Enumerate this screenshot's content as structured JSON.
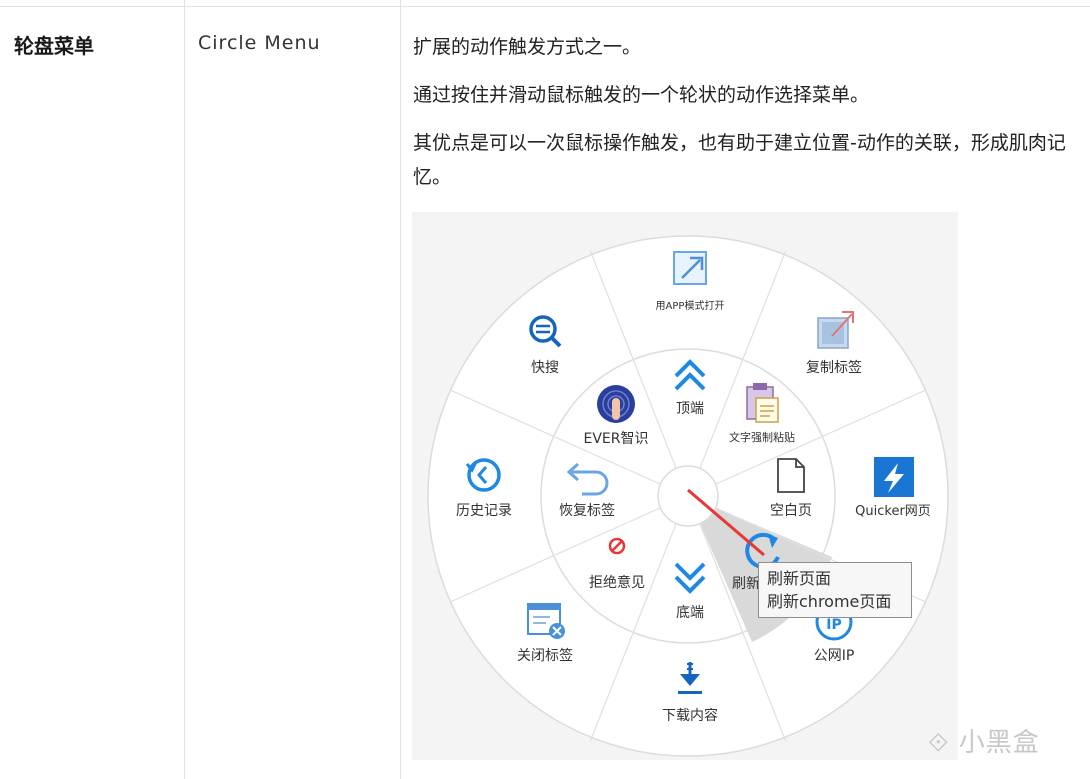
{
  "row": {
    "term": "轮盘菜单",
    "english": "Circle Menu",
    "paragraphs": [
      "扩展的动作触发方式之一。",
      "通过按住并滑动鼠标触发的一个轮状的动作选择菜单。",
      "其优点是可以一次鼠标操作触发，也有助于建立位置-动作的关联，形成肌肉记忆。"
    ]
  },
  "menu": {
    "outer": [
      {
        "label": "用APP模式打开",
        "icon": "open-app-icon"
      },
      {
        "label": "复制标签",
        "icon": "copy-tab-icon"
      },
      {
        "label": "Quicker网页",
        "icon": "quicker-lightning-icon"
      },
      {
        "label": "公网IP",
        "icon": "public-ip-icon"
      },
      {
        "label": "下载内容",
        "icon": "download-icon"
      },
      {
        "label": "关闭标签",
        "icon": "close-tab-icon"
      },
      {
        "label": "历史记录",
        "icon": "history-icon"
      },
      {
        "label": "快搜",
        "icon": "quick-search-icon"
      }
    ],
    "inner": [
      {
        "label": "顶端",
        "icon": "double-chevron-up-icon"
      },
      {
        "label": "文字强制粘贴",
        "icon": "clipboard-paste-icon"
      },
      {
        "label": "空白页",
        "icon": "blank-page-icon"
      },
      {
        "label": "刷新",
        "icon": "refresh-icon"
      },
      {
        "label": "底端",
        "icon": "double-chevron-down-icon"
      },
      {
        "label": "拒绝意见",
        "icon": "forbidden-icon"
      },
      {
        "label": "恢复标签",
        "icon": "undo-arrow-icon"
      },
      {
        "label": "EVER智识",
        "icon": "ever-fingerprint-icon"
      }
    ],
    "accent": "#1e88e5",
    "pointer_color": "#e53935"
  },
  "tooltip": {
    "line1": "刷新页面",
    "line2": "刷新chrome页面"
  },
  "watermark": "小黑盒"
}
